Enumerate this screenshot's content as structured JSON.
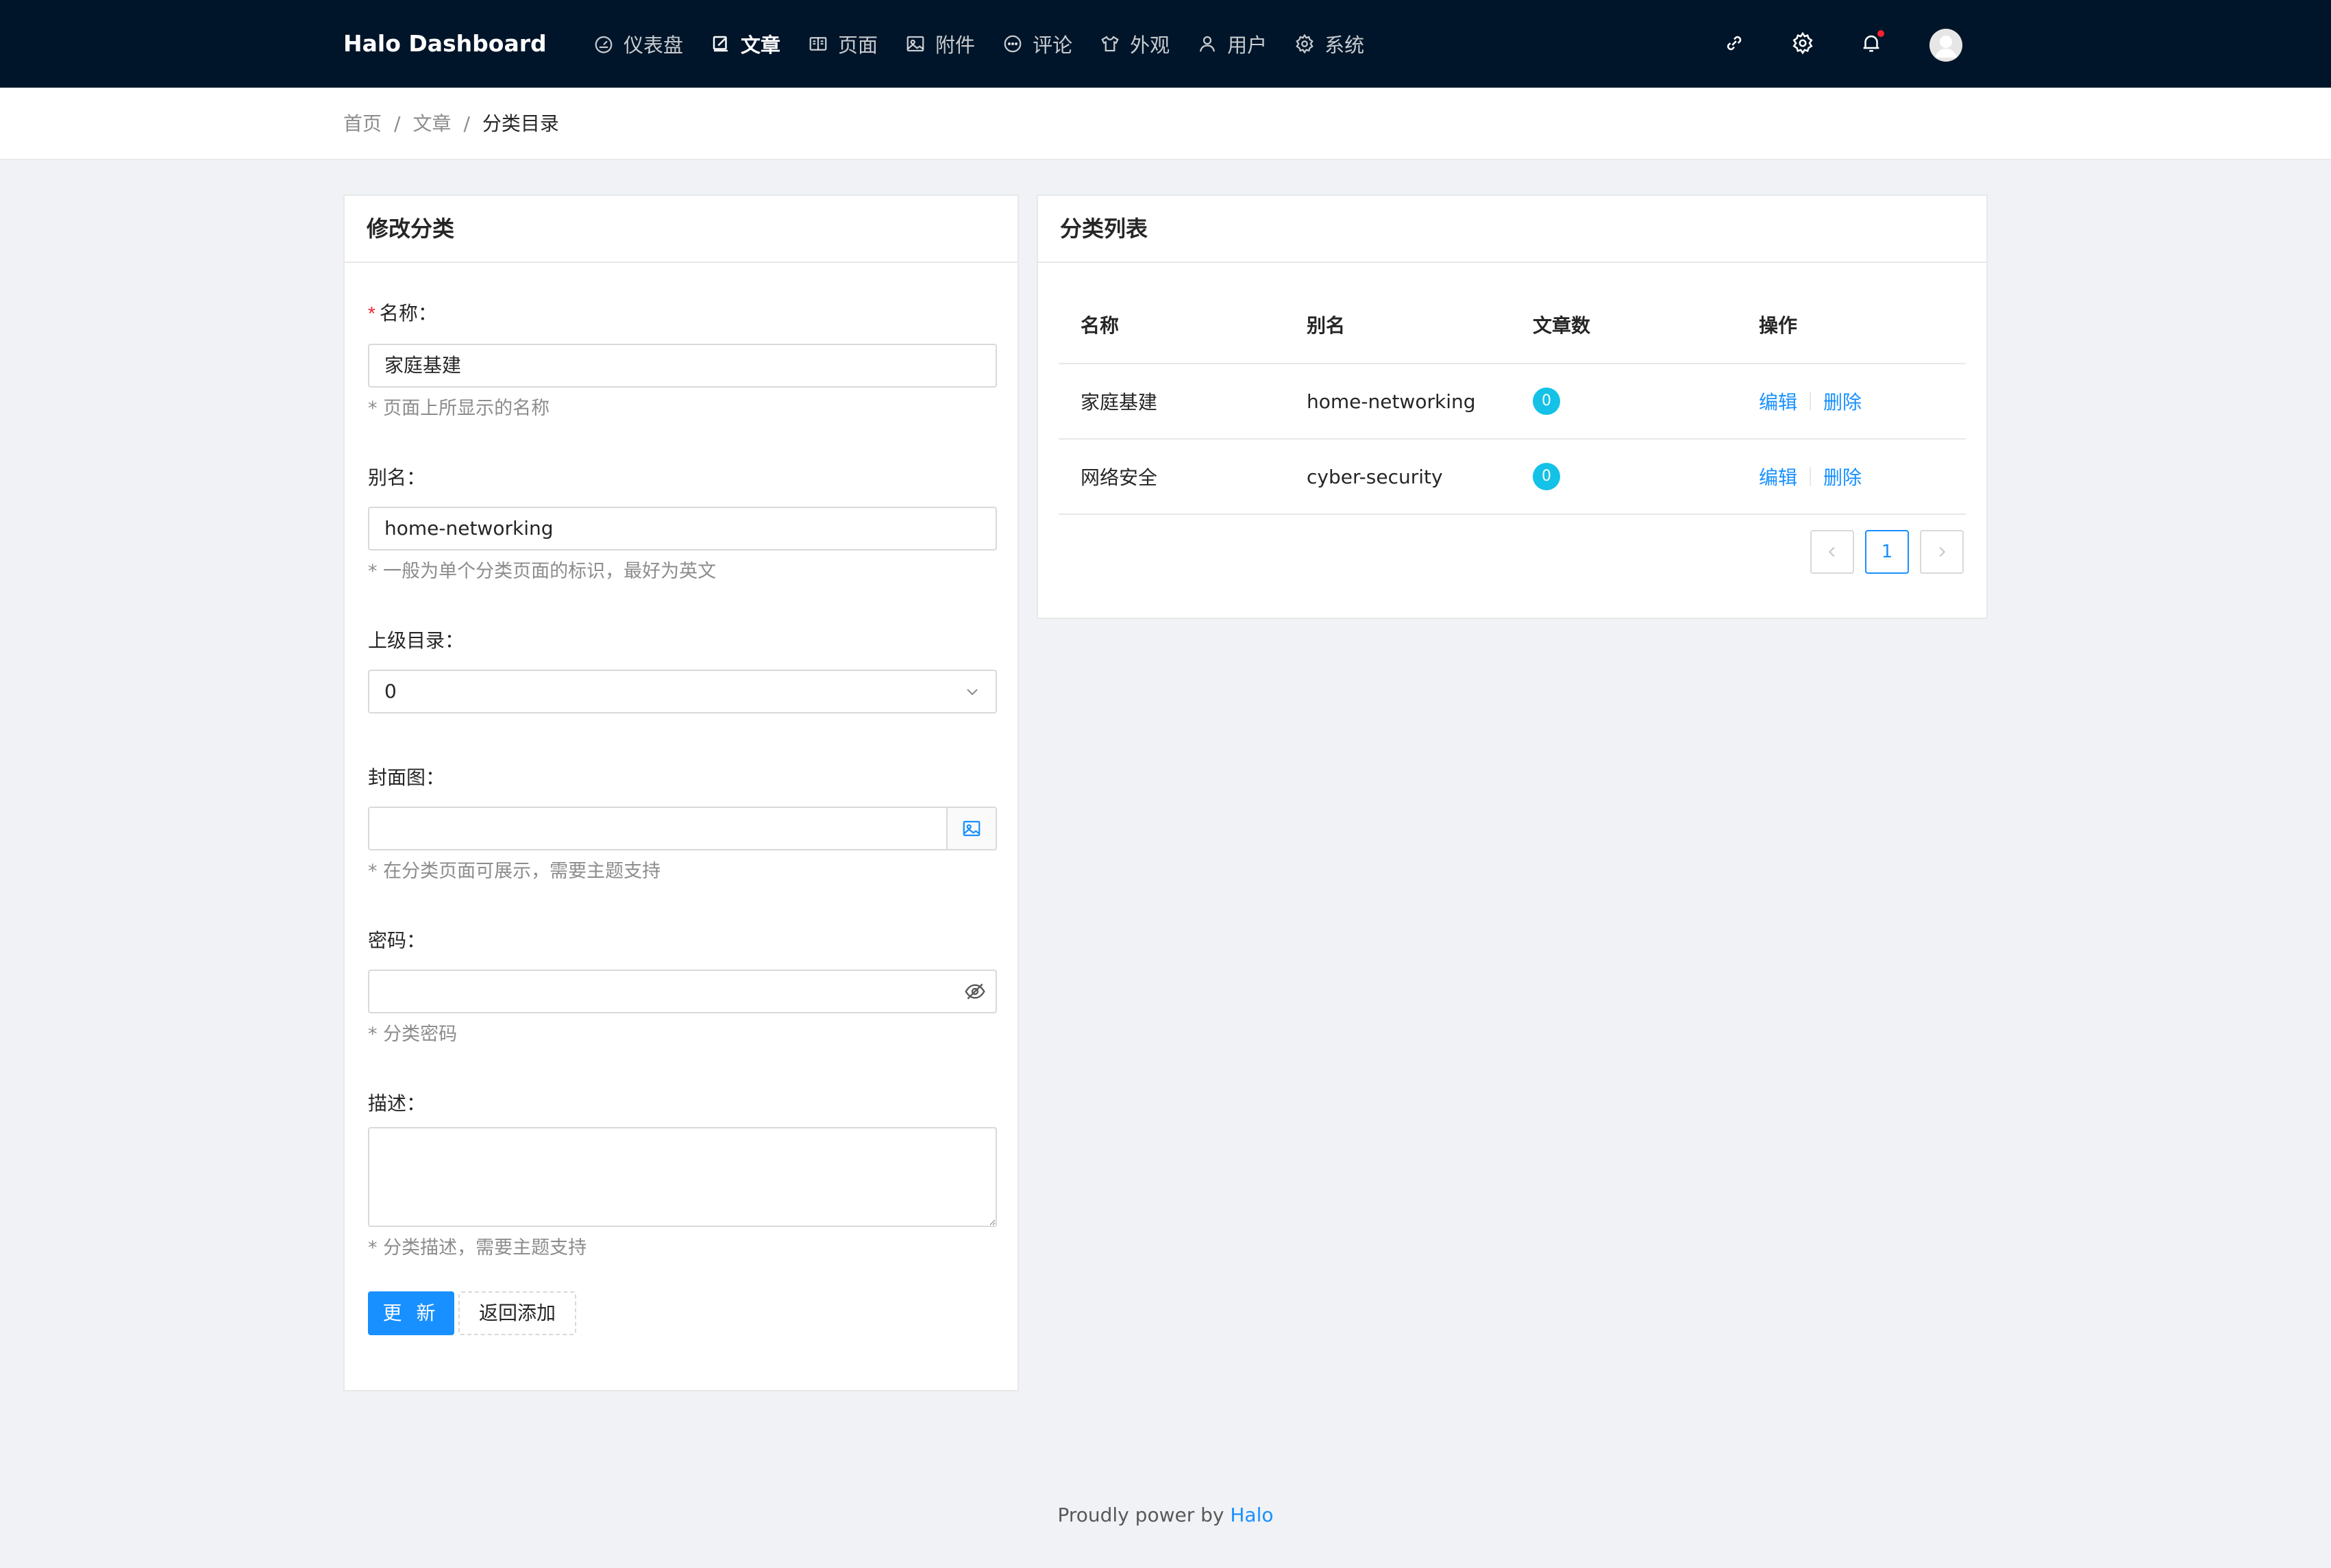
{
  "header": {
    "brand": "Halo  Dashboard",
    "nav": [
      {
        "label": "仪表盘",
        "icon": "dashboard-icon",
        "active": false
      },
      {
        "label": "文章",
        "icon": "edit-icon",
        "active": true
      },
      {
        "label": "页面",
        "icon": "read-icon",
        "active": false
      },
      {
        "label": "附件",
        "icon": "picture-icon",
        "active": false
      },
      {
        "label": "评论",
        "icon": "message-icon",
        "active": false
      },
      {
        "label": "外观",
        "icon": "skin-icon",
        "active": false
      },
      {
        "label": "用户",
        "icon": "user-icon",
        "active": false
      },
      {
        "label": "系统",
        "icon": "setting-icon",
        "active": false
      }
    ],
    "right_icons": [
      "link-icon",
      "setting-icon",
      "bell-icon",
      "avatar"
    ]
  },
  "breadcrumb": [
    "首页",
    "文章",
    "分类目录"
  ],
  "form": {
    "title": "修改分类",
    "name_label": "名称：",
    "name_value": "家庭基建",
    "name_help": "* 页面上所显示的名称",
    "slug_label": "别名：",
    "slug_value": "home-networking",
    "slug_help": "* 一般为单个分类页面的标识，最好为英文",
    "parent_label": "上级目录：",
    "parent_value": "0",
    "cover_label": "封面图：",
    "cover_value": "",
    "cover_help": "* 在分类页面可展示，需要主题支持",
    "password_label": "密码：",
    "password_value": "",
    "password_help": "* 分类密码",
    "desc_label": "描述：",
    "desc_value": "",
    "desc_help": "* 分类描述，需要主题支持",
    "update_button": "更 新",
    "back_button": "返回添加"
  },
  "list": {
    "title": "分类列表",
    "columns": [
      "名称",
      "别名",
      "文章数",
      "操作"
    ],
    "rows": [
      {
        "name": "家庭基建",
        "slug": "home-networking",
        "count": "0",
        "edit": "编辑",
        "delete": "删除"
      },
      {
        "name": "网络安全",
        "slug": "cyber-security",
        "count": "0",
        "edit": "编辑",
        "delete": "删除"
      }
    ],
    "current_page": "1"
  },
  "footer": {
    "text": "Proudly power by ",
    "link": "Halo"
  },
  "colors": {
    "header_bg": "#001529",
    "primary": "#1890ff",
    "badge": "#13c2e6",
    "required": "#f5222d"
  }
}
